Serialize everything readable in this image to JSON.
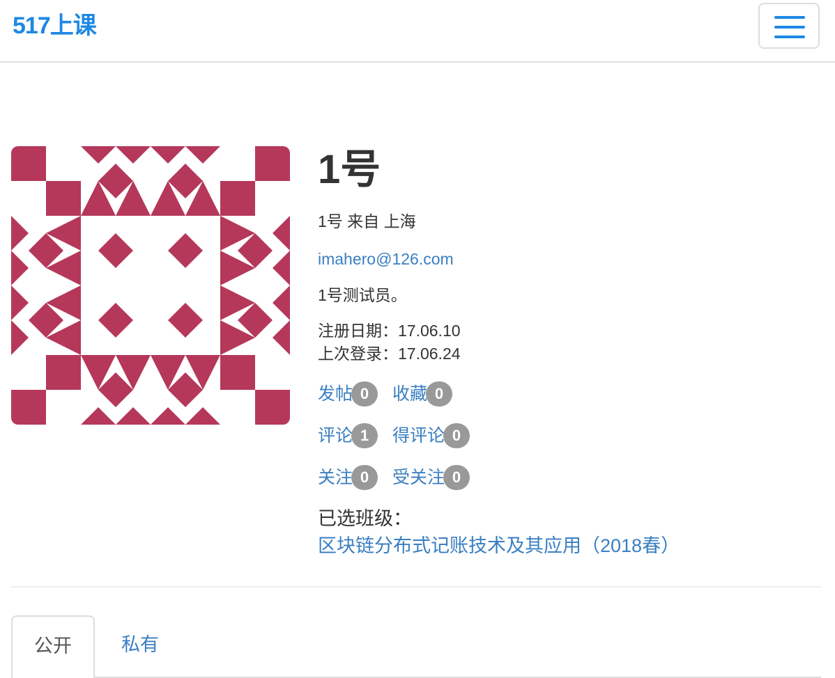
{
  "header": {
    "brand": "517上课",
    "menu_icon": "hamburger-menu-icon",
    "accent_color": "#1e88e5"
  },
  "profile": {
    "avatar": "identicon-avatar",
    "avatar_color": "#b5385a",
    "name": "1号",
    "location_line": "1号  来自 上海",
    "email": "imahero@126.com",
    "bio": "1号测试员。",
    "register_line": "注册日期：17.06.10",
    "last_login_line": "上次登录：17.06.24"
  },
  "stats": {
    "posts": {
      "label": "发帖",
      "count": "0"
    },
    "favorites": {
      "label": "收藏",
      "count": "0"
    },
    "comments": {
      "label": "评论",
      "count": "1"
    },
    "received_comments": {
      "label": "得评论",
      "count": "0"
    },
    "following": {
      "label": "关注",
      "count": "0"
    },
    "followers": {
      "label": "受关注",
      "count": "0"
    }
  },
  "classes": {
    "label": "已选班级：",
    "items": [
      "区块链分布式记账技术及其应用（2018春）"
    ]
  },
  "tabs": [
    {
      "label": "公开",
      "active": true
    },
    {
      "label": "私有",
      "active": false
    }
  ]
}
